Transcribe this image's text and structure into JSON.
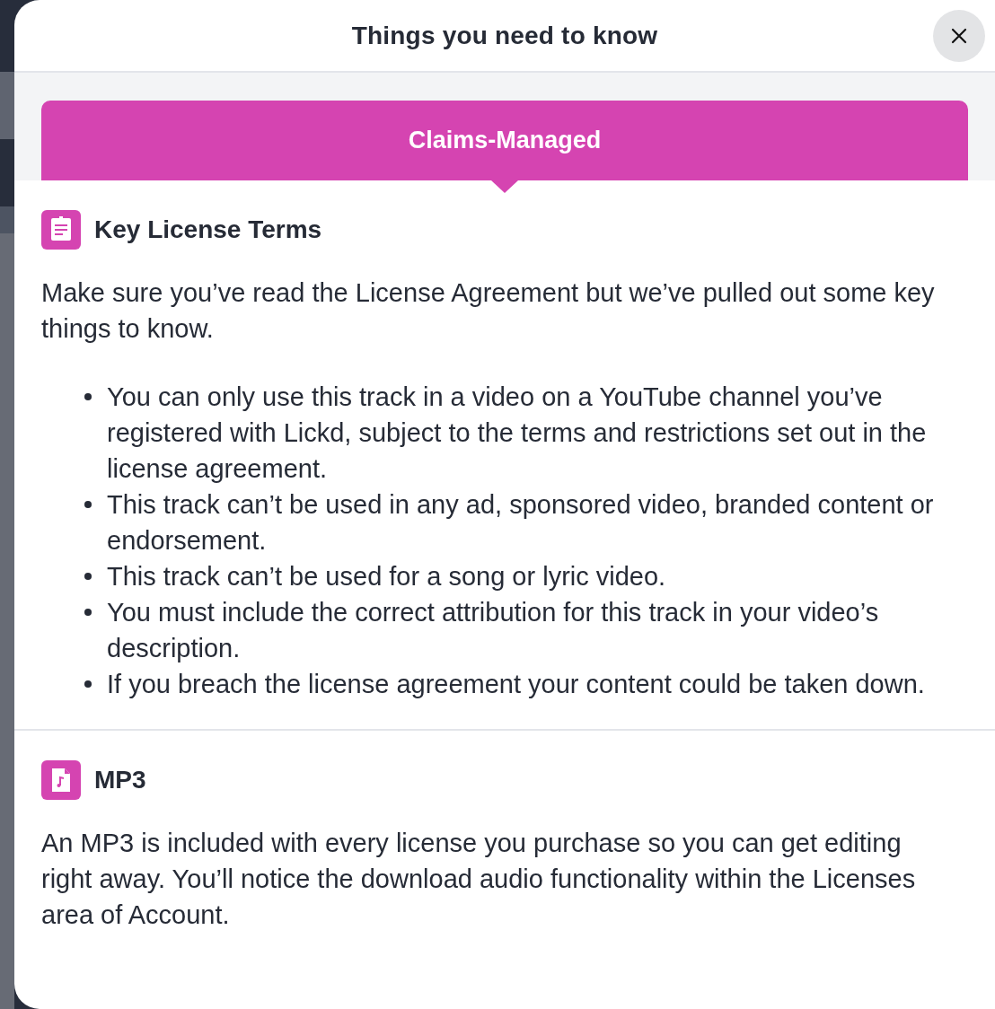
{
  "dialog": {
    "title": "Things you need to know"
  },
  "tabs": [
    {
      "label": "Claims-Managed",
      "selected": true
    }
  ],
  "sections": [
    {
      "kind": "terms",
      "heading": "Key License Terms",
      "intro": "Make sure you’ve read the License Agreement but we’ve pulled out some key things to know.",
      "bullets": [
        "You can only use this track in a video on a YouTube channel you’ve registered with Lickd, subject to the terms and restrictions set out in the license agreement.",
        "This track can’t be used in any ad, sponsored video, branded content or endorsement.",
        "This track can’t be used for a song or lyric video.",
        "You must include the correct attribution for this track in your video’s description.",
        "If you breach the license agreement your content could be taken down."
      ]
    },
    {
      "kind": "audio",
      "heading": "MP3",
      "intro": "An MP3 is included with every license you purchase so you can get editing right away. You’ll notice the download audio functionality within the Licenses area of Account."
    }
  ]
}
